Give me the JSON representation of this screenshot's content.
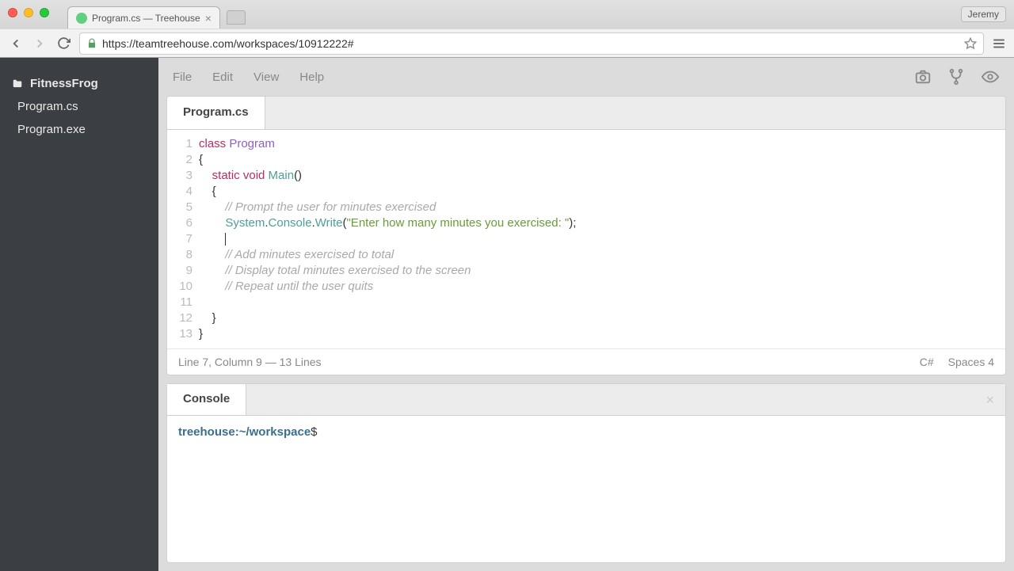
{
  "browser": {
    "tab_title": "Program.cs — Treehouse",
    "url": "https://teamtreehouse.com/workspaces/10912222#",
    "user": "Jeremy"
  },
  "sidebar": {
    "project": "FitnessFrog",
    "files": [
      "Program.cs",
      "Program.exe"
    ]
  },
  "menus": {
    "file": "File",
    "edit": "Edit",
    "view": "View",
    "help": "Help"
  },
  "editor": {
    "tab_name": "Program.cs",
    "status_left": "Line 7, Column 9 — 13 Lines",
    "status_lang": "C#",
    "status_spaces": "Spaces  4",
    "code": {
      "l1_kw": "class ",
      "l1_cls": "Program",
      "l2": "{",
      "l3_kw": "static void ",
      "l3_fn": "Main",
      "l3_paren": "()",
      "l4": "    {",
      "l5_cmt": "        // Prompt the user for minutes exercised",
      "l6_obj1": "System",
      "l6_dot1": ".",
      "l6_obj2": "Console",
      "l6_dot2": ".",
      "l6_fn": "Write",
      "l6_open": "(",
      "l6_str": "\"Enter how many minutes you exercised: \"",
      "l6_close": ");",
      "l7": "        ",
      "l8_cmt": "        // Add minutes exercised to total",
      "l9_cmt": "        // Display total minutes exercised to the screen",
      "l10_cmt": "        // Repeat until the user quits",
      "l11": "",
      "l12": "    }",
      "l13": "}"
    }
  },
  "console": {
    "tab_label": "Console",
    "prompt_host": "treehouse:",
    "prompt_path": "~/workspace",
    "prompt_symbol": "$"
  }
}
